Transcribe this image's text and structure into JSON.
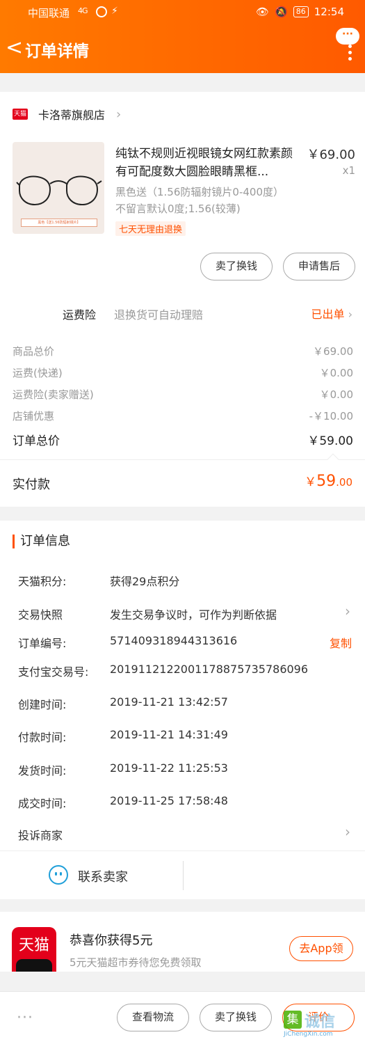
{
  "status_bar": {
    "carrier": "中国联通",
    "signal": "4G",
    "battery": "86",
    "time": "12:54"
  },
  "nav": {
    "title": "订单详情",
    "more_bubble": "···"
  },
  "store": {
    "platform_tag": "天猫",
    "name": "卡洛蒂旗舰店"
  },
  "product": {
    "title": "纯钛不规则近视眼镜女网红款素颜有可配度数大圆脸眼睛黑框...",
    "price": "￥69.00",
    "quantity": "x1",
    "spec": "黑色送（1.56防辐射镜片0-400度）不留言默认0度;1.56(较薄)",
    "return_badge": "七天无理由退换",
    "image_ribbon": "黑色【送1.56防辐射镜片】"
  },
  "item_actions": {
    "sell_label": "卖了换钱",
    "aftersale_label": "申请售后"
  },
  "shipping_insurance": {
    "label": "运费险",
    "desc": "退换货可自动理赔",
    "status": "已出单"
  },
  "fees": [
    {
      "label": "商品总价",
      "value": "￥69.00"
    },
    {
      "label": "运费(快递)",
      "value": "￥0.00"
    },
    {
      "label": "运费险(卖家赠送)",
      "value": "￥0.00"
    },
    {
      "label": "店铺优惠",
      "value": "-￥10.00"
    }
  ],
  "order_total": {
    "label": "订单总价",
    "value": "￥59.00"
  },
  "paid": {
    "label": "实付款",
    "symbol": "￥",
    "integer": "59",
    "decimal": ".00"
  },
  "order_info": {
    "title": "订单信息",
    "rows": [
      {
        "key": "天猫积分:",
        "value": "获得29点积分"
      },
      {
        "key": "交易快照",
        "value": "发生交易争议时，可作为判断依据"
      },
      {
        "key": "订单编号:",
        "value": "571409318944313616",
        "action": "复制"
      },
      {
        "key": "支付宝交易号:",
        "value": "2019112122001178875735786096"
      },
      {
        "key": "创建时间:",
        "value": "2019-11-21 13:42:57"
      },
      {
        "key": "付款时间:",
        "value": "2019-11-21 14:31:49"
      },
      {
        "key": "发货时间:",
        "value": "2019-11-22 11:25:53"
      },
      {
        "key": "成交时间:",
        "value": "2019-11-25 17:58:48"
      },
      {
        "key": "投诉商家",
        "value": ""
      }
    ]
  },
  "contact": {
    "label": "联系卖家"
  },
  "promo": {
    "logo_text": "天猫",
    "title": "恭喜你获得5元",
    "subtitle": "5元天猫超市券待您免费领取",
    "button": "去App领"
  },
  "bottom_bar": {
    "logistics": "查看物流",
    "sell": "卖了换钱",
    "review": "评价"
  },
  "watermark": {
    "icon": "集",
    "text": "诚信",
    "url": "JiChengXin.com"
  },
  "colors": {
    "accent": "#ff5000",
    "header_gradient_start": "#ff7a00",
    "header_gradient_end": "#ff5a00",
    "tmall_red": "#e3001b",
    "contact_blue": "#1f9fd9"
  }
}
